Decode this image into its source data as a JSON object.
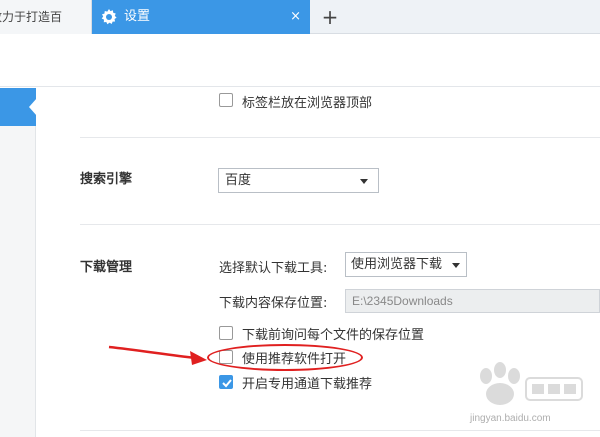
{
  "tabs": {
    "inactive_label": "致力于打造百",
    "active_label": "设置",
    "close_glyph": "×",
    "new_tab_glyph": "+"
  },
  "settings": {
    "tab_position_checkbox": {
      "label": "标签栏放在浏览器顶部",
      "checked": false
    },
    "search_engine": {
      "section_title": "搜索引擎",
      "selected": "百度"
    },
    "downloads": {
      "section_title": "下载管理",
      "default_tool_label": "选择默认下载工具:",
      "default_tool_value": "使用浏览器下载",
      "save_location_label": "下载内容保存位置:",
      "save_location_value": "E:\\2345Downloads",
      "ask_location": {
        "label": "下载前询问每个文件的保存位置",
        "checked": false
      },
      "use_recommended": {
        "label": "使用推荐软件打开",
        "checked": false
      },
      "dedicated_channel": {
        "label": "开启专用通道下载推荐",
        "checked": true
      }
    }
  },
  "watermark": {
    "site": "jingyan.baidu.com"
  },
  "colors": {
    "accent": "#3b97e6",
    "annotation": "#e02020"
  }
}
